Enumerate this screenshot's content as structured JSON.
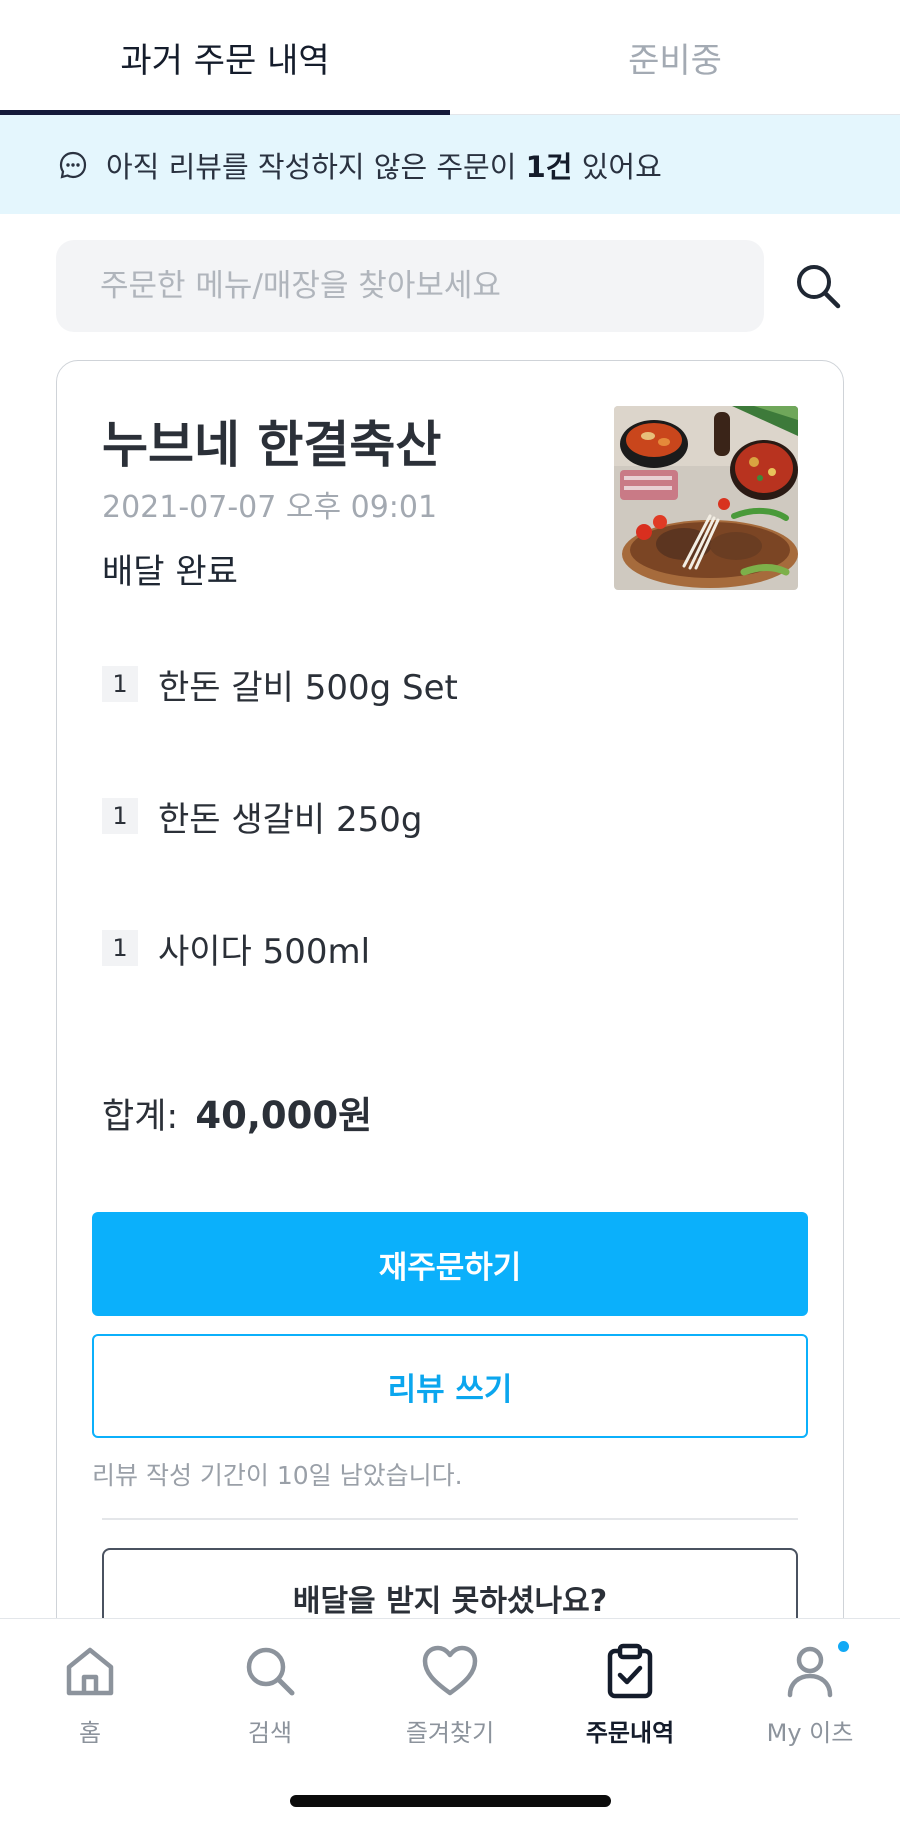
{
  "tabs": [
    {
      "label": "과거 주문 내역"
    },
    {
      "label": "준비중"
    }
  ],
  "notice": {
    "before": "아직 리뷰를 작성하지 않은 주문이 ",
    "count": "1건",
    "after": " 있어요"
  },
  "search": {
    "placeholder": "주문한 메뉴/매장을 찾아보세요",
    "value": ""
  },
  "order": {
    "store_name": "누브네 한결축산",
    "date": "2021-07-07 오후 09:01",
    "status": "배달 완료",
    "items": [
      {
        "qty": "1",
        "name": "한돈 갈비 500g Set"
      },
      {
        "qty": "1",
        "name": "한돈 생갈비 250g"
      },
      {
        "qty": "1",
        "name": "사이다 500ml"
      }
    ],
    "total_label": "합계:",
    "total_amount": "40,000원",
    "reorder_label": "재주문하기",
    "review_label": "리뷰 쓰기",
    "review_deadline": "리뷰 작성 기간이 10일 남았습니다.",
    "not_received_label": "배달을 받지 못하셨나요?"
  },
  "bottom_nav": [
    {
      "label": "홈",
      "icon": "home-icon"
    },
    {
      "label": "검색",
      "icon": "search-icon"
    },
    {
      "label": "즐겨찾기",
      "icon": "heart-icon"
    },
    {
      "label": "주문내역",
      "icon": "clipboard-check-icon",
      "active": true
    },
    {
      "label": "My 이츠",
      "icon": "user-icon",
      "has_notification": true
    }
  ],
  "colors": {
    "accent": "#0bb0fb",
    "notice_bg": "#e4f6fd",
    "tab_underline": "#141a3a",
    "notification_dot": "#12a9f5"
  }
}
